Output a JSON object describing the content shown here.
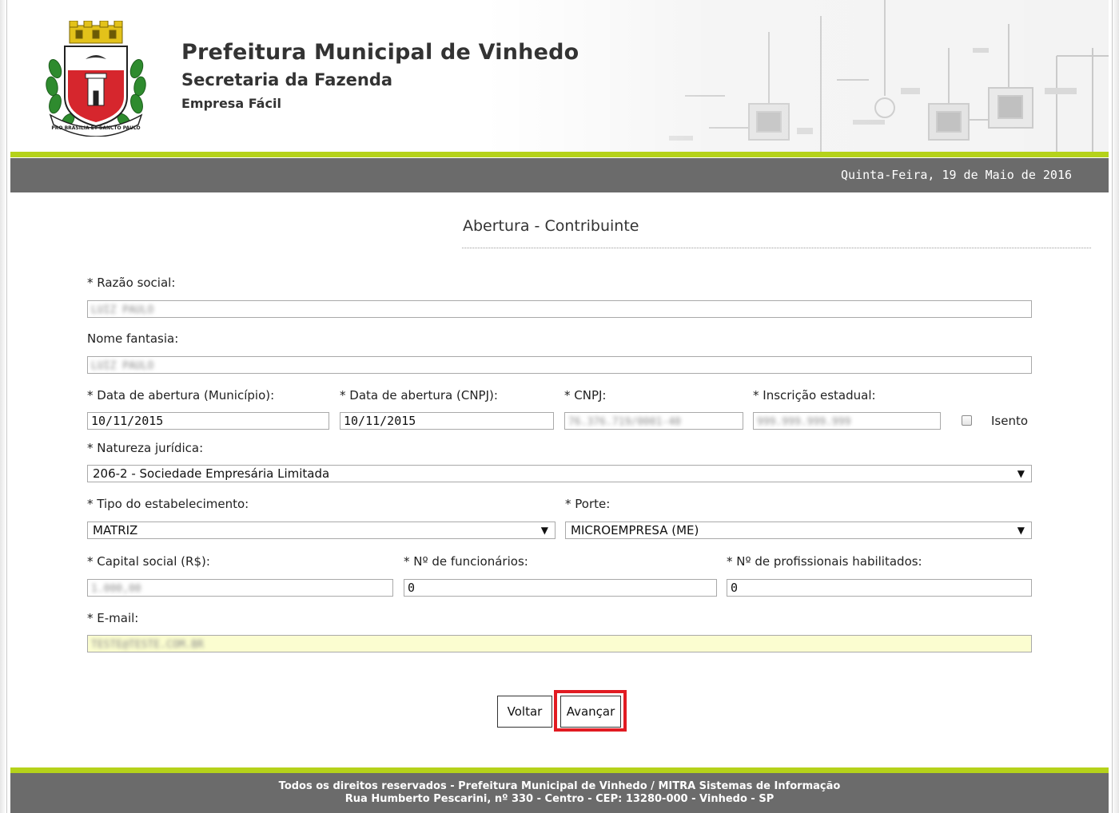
{
  "header": {
    "title": "Prefeitura Municipal de Vinhedo",
    "subtitle": "Secretaria da Fazenda",
    "app_name": "Empresa Fácil",
    "date": "Quinta-Feira, 19 de Maio de 2016"
  },
  "form": {
    "page_title": "Abertura - Contribuinte",
    "razao_social": {
      "label": "* Razão social:",
      "value": "LUIZ PAULO"
    },
    "nome_fantasia": {
      "label": "Nome fantasia:",
      "value": "LUIZ PAULO"
    },
    "data_abertura_municipio": {
      "label": "* Data de abertura (Município):",
      "value": "10/11/2015"
    },
    "data_abertura_cnpj": {
      "label": "* Data de abertura (CNPJ):",
      "value": "10/11/2015"
    },
    "cnpj": {
      "label": "* CNPJ:",
      "value": "76.376.719/0001-40"
    },
    "inscricao_estadual": {
      "label": "* Inscrição estadual:",
      "value": "999.999.999.999"
    },
    "isento": {
      "label": "Isento",
      "checked": false
    },
    "natureza_juridica": {
      "label": "* Natureza jurídica:",
      "value": "206-2 - Sociedade Empresária Limitada"
    },
    "tipo_estabelecimento": {
      "label": "* Tipo do estabelecimento:",
      "value": "MATRIZ"
    },
    "porte": {
      "label": "* Porte:",
      "value": "MICROEMPRESA (ME)"
    },
    "capital_social": {
      "label": "* Capital social (R$):",
      "value": "1.000,00"
    },
    "num_funcionarios": {
      "label": "* Nº de funcionários:",
      "value": "0"
    },
    "num_profissionais": {
      "label": "* Nº de profissionais habilitados:",
      "value": "0"
    },
    "email": {
      "label": "* E-mail:",
      "value": "TESTE@TESTE.COM.BR"
    }
  },
  "buttons": {
    "voltar": "Voltar",
    "avancar": "Avançar"
  },
  "footer": {
    "line1": "Todos os direitos reservados - Prefeitura Municipal de Vinhedo / MITRA Sistemas de Informação",
    "line2": "Rua Humberto Pescarini, nº 330 - Centro - CEP: 13280-000 - Vinhedo - SP"
  },
  "colors": {
    "accent_green": "#b5d21a",
    "bar_gray": "#6b6b6b",
    "highlight_red": "#e11b22",
    "email_field_bg": "#fbfdd0"
  },
  "icons": {
    "logo": "municipal-coat-of-arms",
    "dropdown": "triangle-down-icon"
  }
}
